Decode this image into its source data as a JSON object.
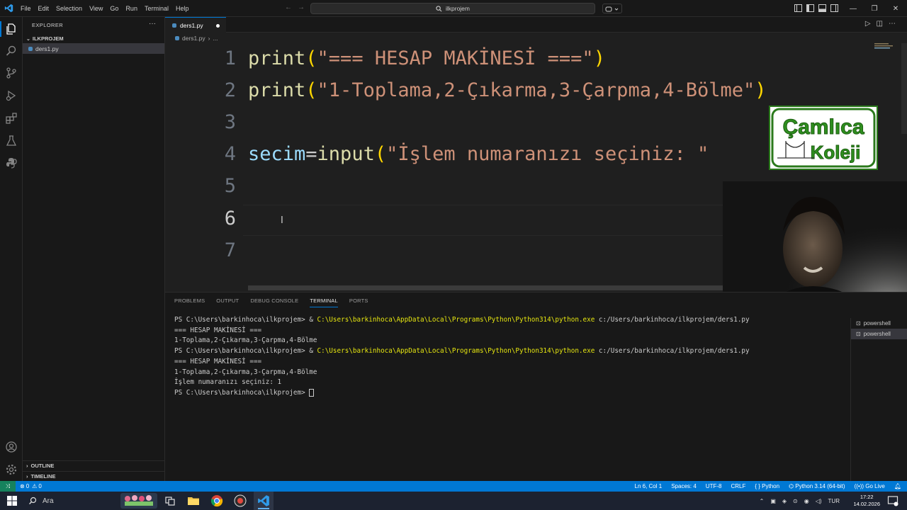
{
  "menu": [
    "File",
    "Edit",
    "Selection",
    "View",
    "Go",
    "Run",
    "Terminal",
    "Help"
  ],
  "command_center": {
    "text": "ilkprojem",
    "icon": "search-icon"
  },
  "sidebar": {
    "title": "EXPLORER",
    "more": "···",
    "folder": "ILKPROJEM",
    "file": "ders1.py",
    "outline": "OUTLINE",
    "timeline": "TIMELINE"
  },
  "editor": {
    "tab": {
      "label": "ders1.py",
      "modified": true
    },
    "breadcrumb_file": "ders1.py",
    "breadcrumb_more": "...",
    "line_numbers": [
      "1",
      "2",
      "3",
      "4",
      "5",
      "6",
      "7"
    ],
    "lines": {
      "l1_fn": "print",
      "l1_str": "\"=== HESAP MAKİNESİ ===\"",
      "l2_fn": "print",
      "l2_str": "\"1-Toplama,2-Çıkarma,3-Çarpma,4-Bölme\"",
      "l4_var": "secim",
      "l4_eq": "=",
      "l4_fn": "input",
      "l4_str": "\"İşlem numaranızı seçiniz: \""
    },
    "paren_open": "(",
    "paren_close": ")"
  },
  "overlay_logo": {
    "line1": "Çamlıca",
    "line2": "Koleji"
  },
  "panel": {
    "tabs": [
      "PROBLEMS",
      "OUTPUT",
      "DEBUG CONSOLE",
      "TERMINAL",
      "PORTS"
    ],
    "active_tab": "TERMINAL",
    "terminal": {
      "prompt": "PS C:\\Users\\barkinhoca\\ilkprojem> ",
      "cmd_amp": "& ",
      "cmd_exe": "C:\\Users\\barkinhoca\\AppData\\Local\\Programs\\Python\\Python314\\python.exe",
      "cmd_arg": " c:/Users/barkinhoca/ilkprojem/ders1.py",
      "out1": "=== HESAP MAKİNESİ ===",
      "out2": "1-Toplama,2-Çıkarma,3-Çarpma,4-Bölme",
      "out3": "İşlem numaranızı seçiniz: 1"
    },
    "terminal_list": [
      "powershell",
      "powershell"
    ]
  },
  "statusbar": {
    "errors": "0",
    "warnings": "0",
    "position": "Ln 6, Col 1",
    "spaces": "Spaces: 4",
    "encoding": "UTF-8",
    "eol": "CRLF",
    "language": "Python",
    "interpreter": "Python 3.14 (64-bit)",
    "golive": "Go Live"
  },
  "taskbar": {
    "search": "Ara",
    "lang": "TUR",
    "time": "17:22",
    "date": "14.02.2026"
  },
  "colors": {
    "accent": "#0078d4",
    "function": "#dcdcaa",
    "string": "#ce9178",
    "variable": "#9cdcfe",
    "bracket": "#ffd700",
    "terminal_path": "#e5e510"
  }
}
